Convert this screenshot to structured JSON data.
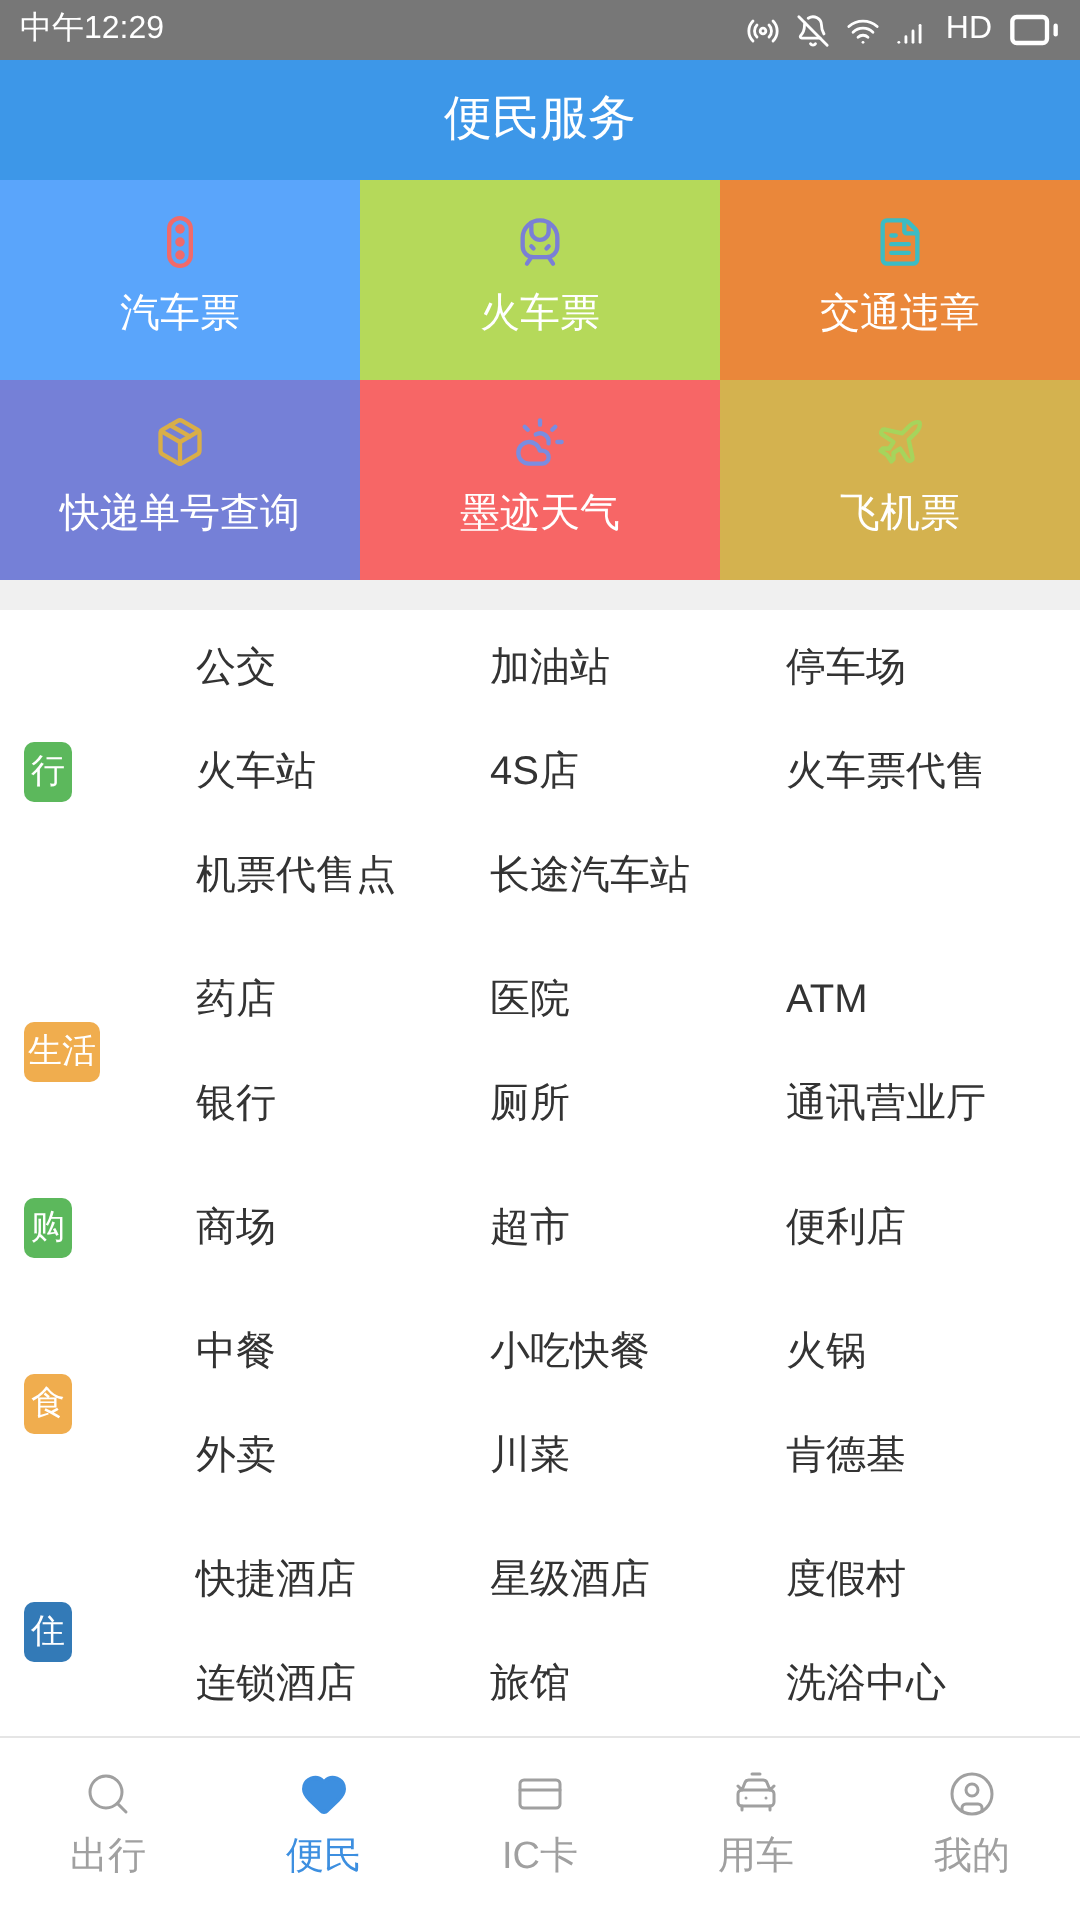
{
  "status_bar": {
    "time": "中午12:29",
    "network": "HD"
  },
  "header": {
    "title": "便民服务"
  },
  "tiles": [
    {
      "label": "汽车票",
      "color": "#5aa5fb"
    },
    {
      "label": "火车票",
      "color": "#b5d95a"
    },
    {
      "label": "交通违章",
      "color": "#ea873a"
    },
    {
      "label": "快递单号查询",
      "color": "#7580d7"
    },
    {
      "label": "墨迹天气",
      "color": "#f76666"
    },
    {
      "label": "飞机票",
      "color": "#d4b24f"
    }
  ],
  "categories": [
    {
      "tag": "行",
      "color": "#5cb85c",
      "items": [
        "公交",
        "加油站",
        "停车场",
        "火车站",
        "4S店",
        "火车票代售",
        "机票代售点",
        "长途汽车站"
      ]
    },
    {
      "tag": "生活",
      "color": "#f0ad4e",
      "items": [
        "药店",
        "医院",
        "ATM",
        "银行",
        "厕所",
        "通讯营业厅"
      ]
    },
    {
      "tag": "购",
      "color": "#5cb85c",
      "items": [
        "商场",
        "超市",
        "便利店"
      ]
    },
    {
      "tag": "食",
      "color": "#f0ad4e",
      "items": [
        "中餐",
        "小吃快餐",
        "火锅",
        "外卖",
        "川菜",
        "肯德基"
      ]
    },
    {
      "tag": "住",
      "color": "#337ab7",
      "items": [
        "快捷酒店",
        "星级酒店",
        "度假村",
        "连锁酒店",
        "旅馆",
        "洗浴中心"
      ]
    }
  ],
  "nav": [
    {
      "label": "出行",
      "selected": false
    },
    {
      "label": "便民",
      "selected": true
    },
    {
      "label": "IC卡",
      "selected": false
    },
    {
      "label": "用车",
      "selected": false
    },
    {
      "label": "我的",
      "selected": false
    }
  ]
}
